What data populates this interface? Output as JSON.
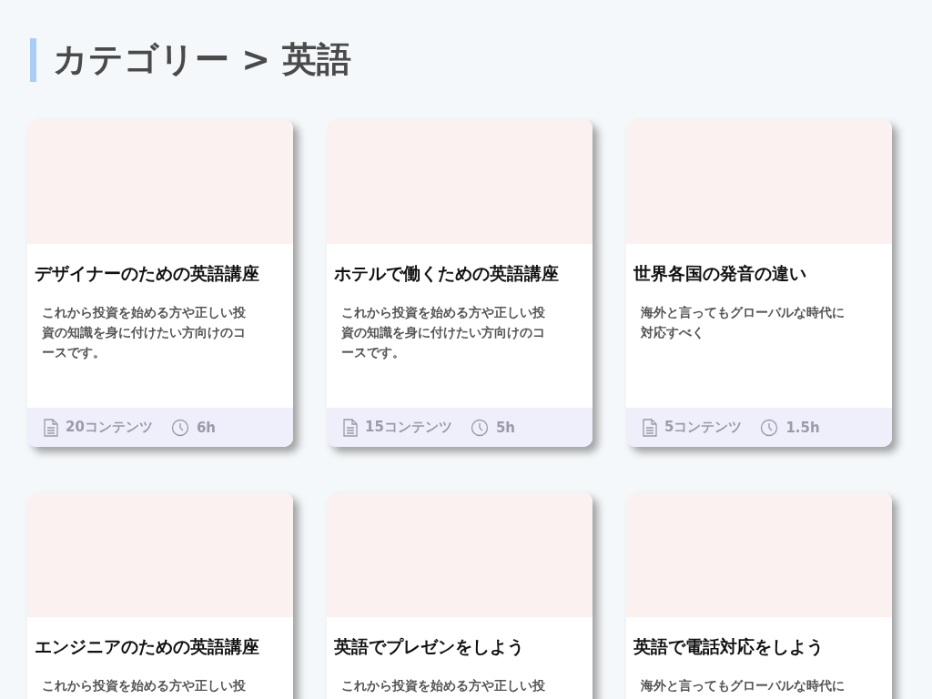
{
  "heading": "カテゴリー > 英語",
  "courses": [
    {
      "title": "デザイナーのための英語講座",
      "description": "これから投資を始める方や正しい投資の知識を身に付けたい方向けのコースです。",
      "contents": "20コンテンツ",
      "duration": "6h"
    },
    {
      "title": "ホテルで働くための英語講座",
      "description": "これから投資を始める方や正しい投資の知識を身に付けたい方向けのコースです。",
      "contents": "15コンテンツ",
      "duration": "5h"
    },
    {
      "title": "世界各国の発音の違い",
      "description": "海外と言ってもグローバルな時代に対応すべく",
      "contents": "5コンテンツ",
      "duration": "1.5h"
    },
    {
      "title": "エンジニアのための英語講座",
      "description": "これから投資を始める方や正しい投"
    },
    {
      "title": "英語でプレゼンをしよう",
      "description": "これから投資を始める方や正しい投"
    },
    {
      "title": "英語で電話対応をしよう",
      "description": "海外と言ってもグローバルな時代に"
    }
  ]
}
